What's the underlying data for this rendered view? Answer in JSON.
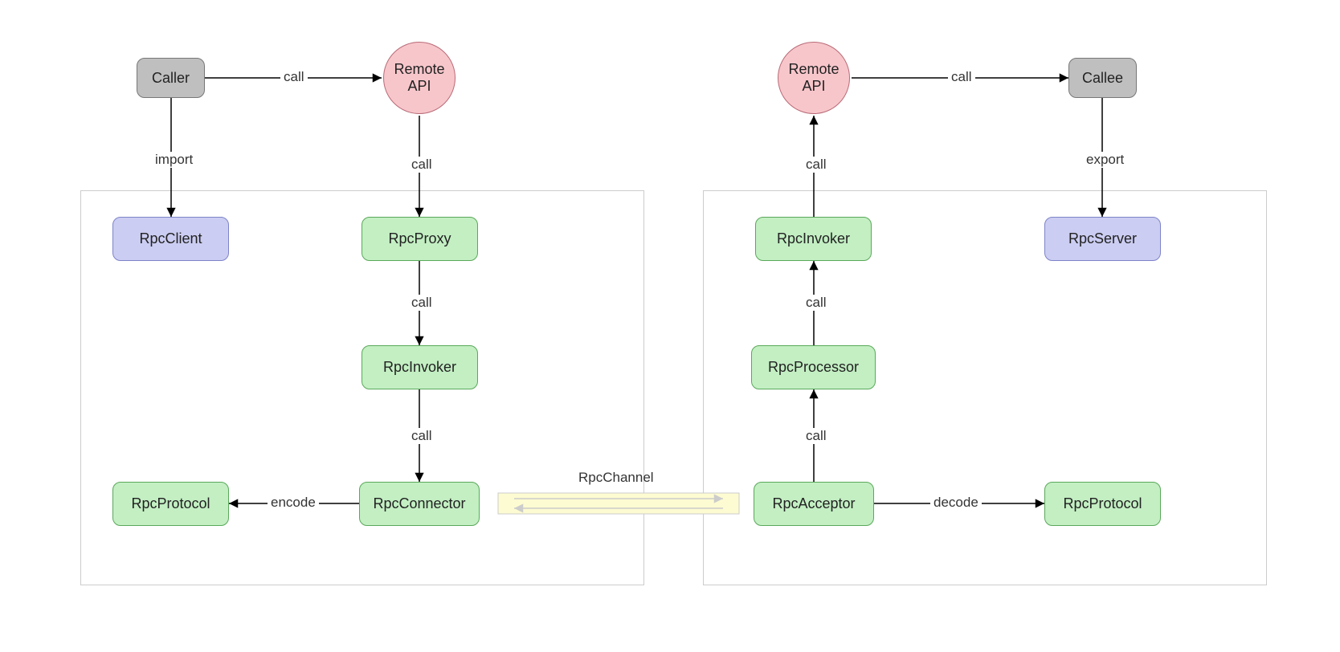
{
  "nodes": {
    "caller": "Caller",
    "remoteApiL": "Remote\nAPI",
    "remoteApiR": "Remote\nAPI",
    "callee": "Callee",
    "rpcClient": "RpcClient",
    "rpcProxy": "RpcProxy",
    "rpcInvokerL": "RpcInvoker",
    "rpcConnector": "RpcConnector",
    "rpcProtocolL": "RpcProtocol",
    "rpcInvokerR": "RpcInvoker",
    "rpcProcessor": "RpcProcessor",
    "rpcAcceptor": "RpcAcceptor",
    "rpcProtocolR": "RpcProtocol",
    "rpcServer": "RpcServer"
  },
  "edges": {
    "caller_to_api": "call",
    "api_to_callee": "call",
    "caller_to_client": "import",
    "callee_to_server": "export",
    "api_to_proxy": "call",
    "proxy_to_invoker": "call",
    "invoker_to_connector": "call",
    "connector_to_protocol": "encode",
    "invokerR_to_api": "call",
    "processor_to_invoker": "call",
    "acceptor_to_processor": "call",
    "acceptor_to_protocol": "decode",
    "channel": "RpcChannel"
  }
}
